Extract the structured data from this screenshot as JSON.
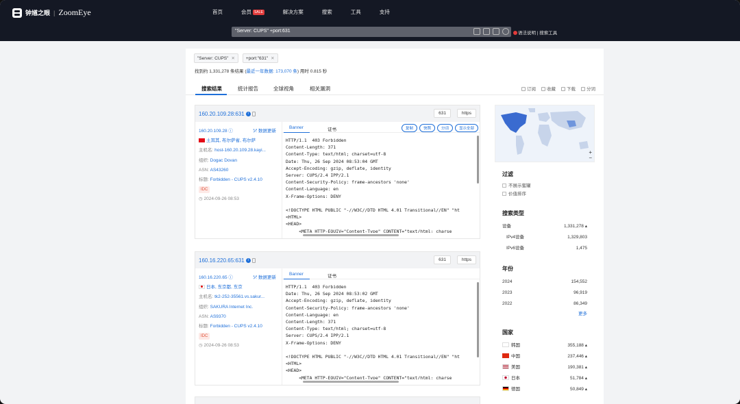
{
  "header": {
    "brand_cn": "钟馗之眼",
    "brand_sep": "|",
    "brand_en": "ZoomEye",
    "nav": [
      "首页",
      "会员",
      "解决方案",
      "搜索",
      "工具",
      "支持"
    ],
    "sale_badge": "SALE",
    "search_query": "\"Server: CUPS\" +port:631",
    "help": "语法说明 | 搜索工具"
  },
  "filters": {
    "chips": [
      "\"Server: CUPS\"",
      "+port:\"631\""
    ],
    "summary_prefix": "找到约 1,331,278 条结果 (",
    "summary_link": "最近一年数据: 173,070 条",
    "summary_suffix": ") 用时 0.815 秒"
  },
  "tabs": [
    "搜索结果",
    "统计报告",
    "全球视角",
    "相关漏洞"
  ],
  "actions": [
    "订阅",
    "收藏",
    "下载",
    "分词"
  ],
  "results": [
    {
      "ip_port": "160.20.109.28:631",
      "ip": "160.20.109.28",
      "refresh": "数据更新",
      "location": "土耳其, 布尔萨省, 布尔萨",
      "host_label": "主机名: ",
      "host": "host-160.20.109.28.kayi...",
      "org_label": "组织: ",
      "org": "Dogac Dovan",
      "asn_label": "ASN: ",
      "asn": "AS43260",
      "title_label": "标题: ",
      "title": "Forbidden - CUPS v2.4.10",
      "tag": "IDC",
      "time": "2024-09-26 08:53",
      "port": "631",
      "service": "https",
      "banner_tabs": [
        "Banner",
        "证书"
      ],
      "banner_btns": [
        "复制",
        "快照",
        "分词",
        "显示全部"
      ],
      "banner": "HTTP/1.1  403 Forbidden\nContent-Length: 371\nContent-Type: text/html; charset=utf-8\nDate: Thu, 26 Sep 2024 08:53:04 GMT\nAccept-Encoding: gzip, deflate, identity\nServer: CUPS/2.4 IPP/2.1\nContent-Security-Policy: frame-ancestors 'none'\nContent-Language: en\nX-Frame-Options: DENY\n\n<!DOCTYPE HTML PUBLIC \"-//W3C//DTD HTML 4.01 Transitional//EN\" \"ht\n<HTML>\n<HEAD>\n     <META HTTP-EQUIV=\"Content-Type\" CONTENT=\"text/html; charse"
    },
    {
      "ip_port": "160.16.220.65:631",
      "ip": "160.16.220.65",
      "refresh": "数据更新",
      "location": "日本, 东京都, 东京",
      "host_label": "主机名: ",
      "host": "tk2-252-35561.vs.sakur...",
      "org_label": "组织: ",
      "org": "SAKURA Internet Inc.",
      "asn_label": "ASN: ",
      "asn": "AS9370",
      "title_label": "标题: ",
      "title": "Forbidden - CUPS v2.4.10",
      "tag": "IDC",
      "time": "2024-09-26 08:53",
      "port": "631",
      "service": "https",
      "banner_tabs": [
        "Banner",
        "证书"
      ],
      "banner": "HTTP/1.1  403 Forbidden\nDate: Thu, 26 Sep 2024 08:53:02 GMT\nAccept-Encoding: gzip, deflate, identity\nContent-Security-Policy: frame-ancestors 'none'\nContent-Language: en\nContent-Length: 371\nContent-Type: text/html; charset=utf-8\nServer: CUPS/2.4 IPP/2.1\nX-Frame-Options: DENY\n\n<!DOCTYPE HTML PUBLIC \"-//W3C//DTD HTML 4.01 Transitional//EN\" \"ht\n<HTML>\n<HEAD>\n     <META HTTP-EQUIV=\"Content-Type\" CONTENT=\"text/html; charse"
    }
  ],
  "sidebar": {
    "filter_title": "过滤",
    "filter_opts": [
      "不展示蜜罐",
      "价值排序"
    ],
    "type_title": "搜索类型",
    "types": [
      {
        "label": "设备",
        "value": "1,331,278"
      },
      {
        "label": "IPv4设备",
        "value": "1,329,803"
      },
      {
        "label": "IPv6设备",
        "value": "1,475"
      }
    ],
    "year_title": "年份",
    "years": [
      {
        "label": "2024",
        "value": "154,552"
      },
      {
        "label": "2023",
        "value": "96,919"
      },
      {
        "label": "2022",
        "value": "86,349"
      }
    ],
    "more": "更多",
    "country_title": "国家",
    "countries": [
      {
        "label": "韩国",
        "value": "355,188"
      },
      {
        "label": "中国",
        "value": "237,446"
      },
      {
        "label": "美国",
        "value": "190,381"
      },
      {
        "label": "日本",
        "value": "51,784"
      },
      {
        "label": "德国",
        "value": "50,849"
      }
    ]
  }
}
